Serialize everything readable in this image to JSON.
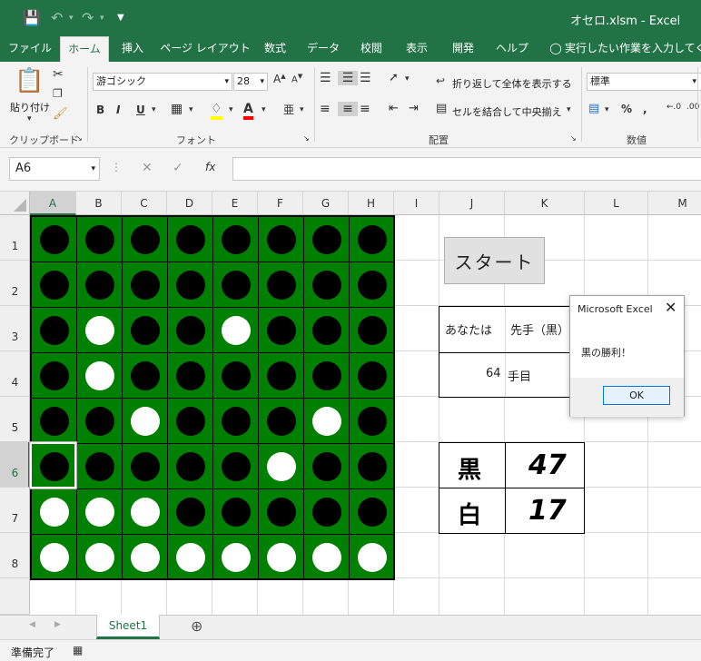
{
  "window": {
    "title": "オセロ.xlsm  -  Excel",
    "accent_color": "#217346"
  },
  "tabs": [
    "ファイル",
    "ホーム",
    "挿入",
    "ページ レイアウト",
    "数式",
    "データ",
    "校閲",
    "表示",
    "開発",
    "ヘルプ",
    "実行したい作業を入力してください"
  ],
  "ribbon": {
    "paste_label": "貼り付け",
    "font_name": "游ゴシック",
    "font_size": "28",
    "wrap_text": "折り返して全体を表示する",
    "merge_center": "セルを結合して中央揃え",
    "number_format": "標準",
    "group_clipboard": "クリップボード",
    "group_font": "フォント",
    "group_alignment": "配置",
    "group_number": "数値"
  },
  "formula_bar": {
    "name_box": "A6",
    "formula": ""
  },
  "columns": [
    "A",
    "B",
    "C",
    "D",
    "E",
    "F",
    "G",
    "H",
    "I",
    "J",
    "K",
    "L",
    "M"
  ],
  "selected_column": "A",
  "rows": [
    "1",
    "2",
    "3",
    "4",
    "5",
    "6",
    "7",
    "8"
  ],
  "selected_row": "6",
  "board": [
    [
      "b",
      "b",
      "b",
      "b",
      "b",
      "b",
      "b",
      "b"
    ],
    [
      "b",
      "b",
      "b",
      "b",
      "b",
      "b",
      "b",
      "b"
    ],
    [
      "b",
      "w",
      "b",
      "b",
      "w",
      "b",
      "b",
      "b"
    ],
    [
      "b",
      "w",
      "b",
      "b",
      "b",
      "b",
      "b",
      "b"
    ],
    [
      "b",
      "b",
      "w",
      "b",
      "b",
      "b",
      "w",
      "b"
    ],
    [
      "b",
      "b",
      "b",
      "b",
      "b",
      "w",
      "b",
      "b"
    ],
    [
      "w",
      "w",
      "w",
      "b",
      "b",
      "b",
      "b",
      "b"
    ],
    [
      "w",
      "w",
      "w",
      "w",
      "w",
      "w",
      "w",
      "w"
    ]
  ],
  "board_color": "#008000",
  "start_button": "スタート",
  "info": {
    "you_are_label": "あなたは",
    "player_side": "先手（黒）",
    "move_count": "64",
    "move_unit": "手目"
  },
  "score": {
    "black_label": "黒",
    "black_count": "47",
    "white_label": "白",
    "white_count": "17"
  },
  "dialog": {
    "title": "Microsoft Excel",
    "message": "黒の勝利！",
    "ok_label": "OK"
  },
  "sheet_tab": "Sheet1",
  "status": "準備完了"
}
